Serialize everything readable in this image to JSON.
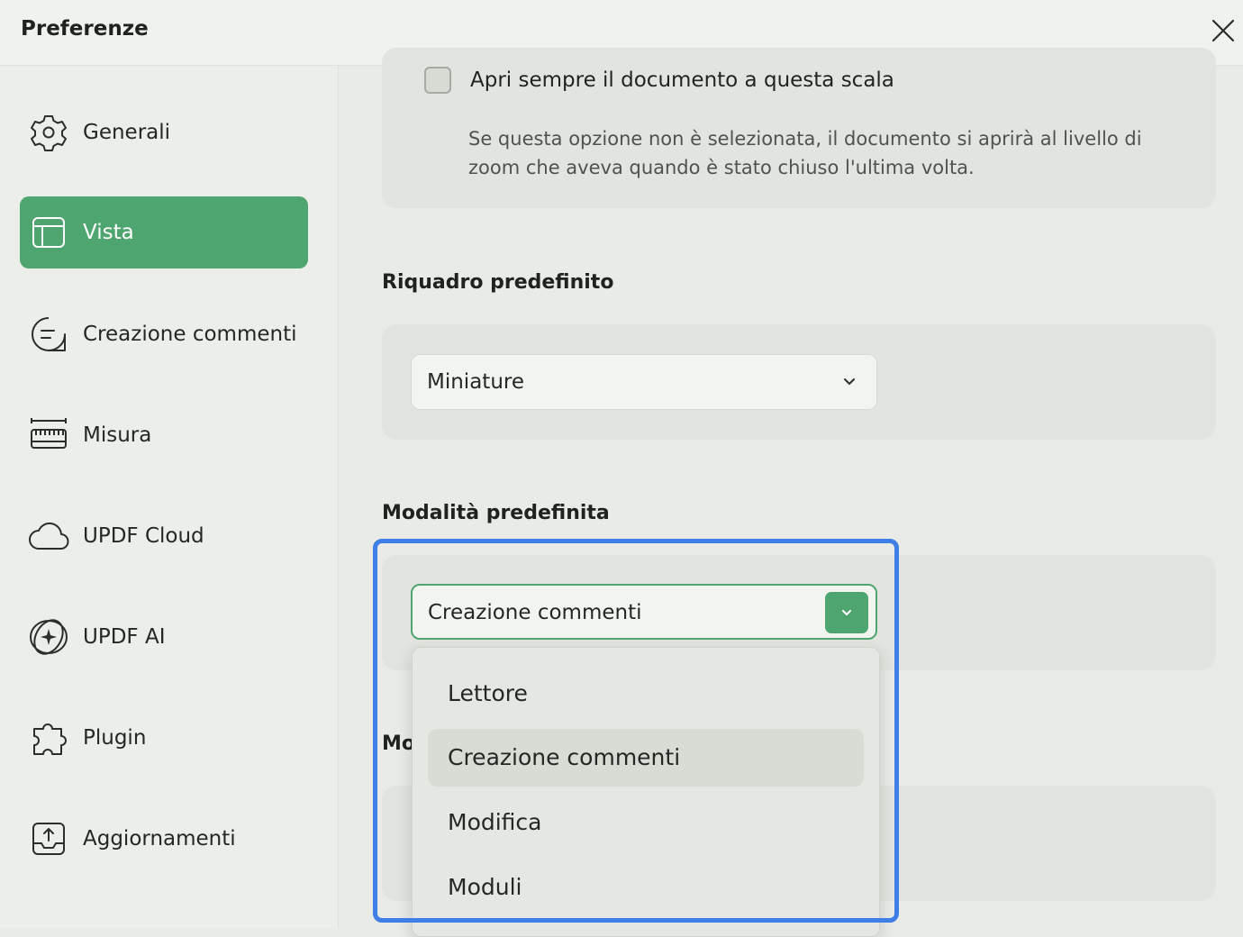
{
  "window": {
    "title": "Preferenze",
    "close_icon": "close-icon"
  },
  "sidebar": {
    "items": [
      {
        "label": "Generali",
        "icon": "gear-icon"
      },
      {
        "label": "Vista",
        "icon": "layout-icon",
        "active": true
      },
      {
        "label": "Creazione commenti",
        "icon": "comment-icon"
      },
      {
        "label": "Misura",
        "icon": "ruler-icon"
      },
      {
        "label": "UPDF Cloud",
        "icon": "cloud-icon"
      },
      {
        "label": "UPDF AI",
        "icon": "ai-sparkle-icon"
      },
      {
        "label": "Plugin",
        "icon": "puzzle-icon"
      },
      {
        "label": "Aggiornamenti",
        "icon": "upload-update-icon"
      }
    ],
    "accent_color": "#4fa56f"
  },
  "main": {
    "scale_option": {
      "checkbox_label": "Apri sempre il documento a questa scala",
      "checked": false,
      "description": "Se questa opzione non è selezionata, il documento si aprirà al livello di zoom che aveva quando è stato chiuso l'ultima volta."
    },
    "default_panel": {
      "heading": "Riquadro predefinito",
      "selected": "Miniature"
    },
    "default_mode": {
      "heading": "Modalità predefinita",
      "selected": "Creazione commenti",
      "options": [
        "Lettore",
        "Creazione commenti",
        "Modifica",
        "Moduli"
      ],
      "highlighted_option": "Creazione commenti"
    },
    "partially_hidden_heading": "Mo"
  },
  "highlight_color": "#3f7ee6"
}
